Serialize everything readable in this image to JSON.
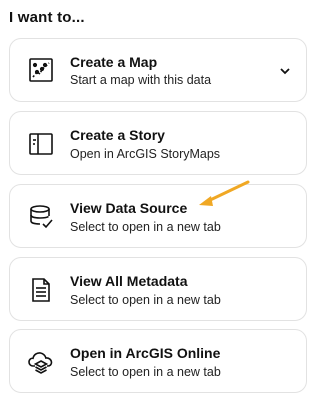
{
  "heading": "I want to...",
  "accent_color": "#f0a824",
  "options": [
    {
      "title": "Create a Map",
      "subtitle": "Start a map with this data",
      "icon": "map-icon",
      "expandable": true
    },
    {
      "title": "Create a Story",
      "subtitle": "Open in ArcGIS StoryMaps",
      "icon": "story-icon",
      "expandable": false
    },
    {
      "title": "View Data Source",
      "subtitle": "Select to open in a new tab",
      "icon": "database-icon",
      "expandable": false
    },
    {
      "title": "View All Metadata",
      "subtitle": "Select to open in a new tab",
      "icon": "document-icon",
      "expandable": false
    },
    {
      "title": "Open in ArcGIS Online",
      "subtitle": "Select to open in a new tab",
      "icon": "cloud-icon",
      "expandable": false
    }
  ]
}
